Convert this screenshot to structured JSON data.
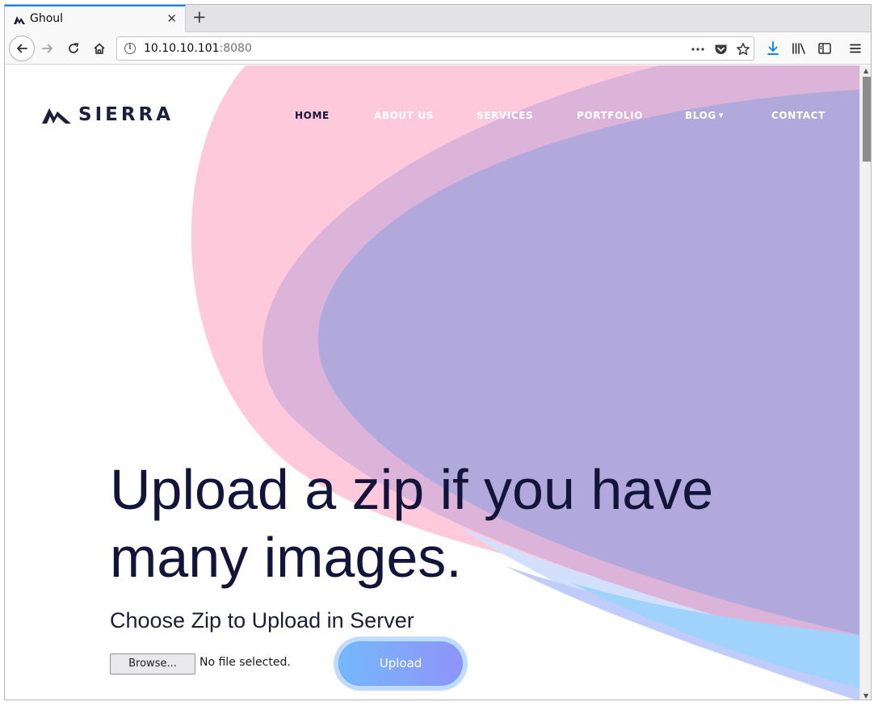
{
  "browser": {
    "tab": {
      "title": "Ghoul",
      "favicon": "sierra-logo-icon"
    },
    "url": {
      "host": "10.10.10.101",
      "port": ":8080"
    },
    "icons": {
      "back": "back-arrow-icon",
      "forward": "forward-arrow-icon",
      "reload": "reload-icon",
      "home": "home-icon",
      "page_actions": "more-dots-icon",
      "pocket": "pocket-icon",
      "bookmark": "star-icon",
      "downloads": "download-icon",
      "library": "library-icon",
      "sidebar": "sidebar-icon",
      "menu": "hamburger-menu-icon"
    }
  },
  "site": {
    "logo_text": "SIERRA",
    "nav": [
      {
        "label": "HOME",
        "active": true
      },
      {
        "label": "ABOUT US"
      },
      {
        "label": "SERVICES"
      },
      {
        "label": "PORTFOLIO"
      },
      {
        "label": "BLOG"
      },
      {
        "label": "CONTACT"
      }
    ],
    "hero": {
      "line1": "Upload a zip if you have",
      "line2": "many images."
    },
    "form": {
      "heading": "Choose Zip to Upload in Server",
      "browse_label": "Browse...",
      "file_status": "No file selected.",
      "upload_label": "Upload"
    }
  },
  "colors": {
    "accent_blue": "#0a84ff",
    "pink_wave": "#ffc9dc",
    "mauve_wave": "#dcb3d9",
    "purple_wave": "#b1a8db",
    "sky_wave": "#9fd3fc",
    "nav_dark": "#13163b"
  }
}
